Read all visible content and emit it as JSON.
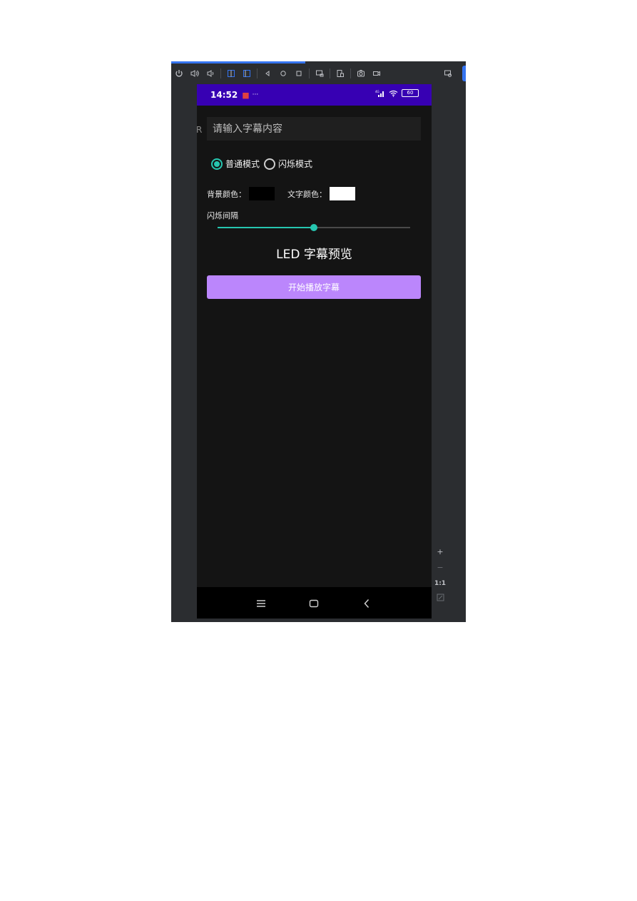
{
  "statusbar": {
    "time": "14:52",
    "notif_icon": "app-notification-icon",
    "dots": "···",
    "network": "⁴ᴳ",
    "battery": "60"
  },
  "edge_letter": "R",
  "input": {
    "placeholder": "请输入字幕内容",
    "value": ""
  },
  "mode": {
    "options": [
      "普通模式",
      "闪烁模式"
    ],
    "selected_index": 0
  },
  "colors": {
    "bg_label": "背景颜色：",
    "bg_value": "#000000",
    "text_label": "文字颜色：",
    "text_value": "#ffffff",
    "accent": "#26c6b0",
    "button": "#bb86fc",
    "statusbar": "#3700b3"
  },
  "slider": {
    "label": "闪烁间隔",
    "value_fraction": 0.5
  },
  "preview_text": "LED 字幕预览",
  "play_button_label": "开始播放字幕",
  "side_tools": {
    "zoom_in": "+",
    "zoom_out": "−",
    "one_to_one": "1:1"
  }
}
